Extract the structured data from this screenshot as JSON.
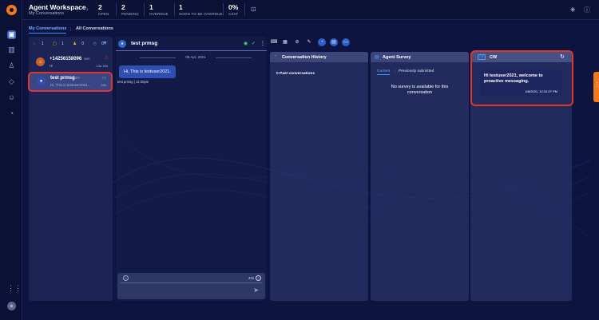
{
  "header": {
    "app_title": "Agent Workspace",
    "app_subtitle": "My Conversations",
    "crumb_icon": "chevron-right-icon",
    "stats": [
      {
        "value": "2",
        "label": "OPEN"
      },
      {
        "value": "2",
        "label": "PENDING"
      },
      {
        "value": "1",
        "label": "OVERDUE"
      },
      {
        "value": "1",
        "label": "SOON TO BE OVERDUE"
      },
      {
        "value": "0%",
        "label": "CSAT"
      }
    ]
  },
  "tabs": {
    "my_conversations": "My Conversations",
    "all_conversations": "All Conversations"
  },
  "filters": {
    "counts": [
      "1",
      "1",
      "0",
      "0"
    ],
    "icons": [
      "fire-icon",
      "chat-icon",
      "group-icon",
      "clock-icon"
    ]
  },
  "conversations": [
    {
      "name": "+14256158096",
      "channel": "SMS",
      "preview": "Hi",
      "time": "-13d 16h",
      "status_icon": "bell-icon",
      "status_color": "#e3342f"
    },
    {
      "name": "test prmsg",
      "channel": "APP",
      "preview": "Hi, This is testuser2021...",
      "time": "59s",
      "status_icon": "chat-icon",
      "status_color": "#4cd964"
    }
  ],
  "chat": {
    "contact_name": "test prmsg",
    "date": "08 Apr, 2021",
    "message": "Hi, This is testuser2021.",
    "meta": "test prmsg  |  12:30pm",
    "char_count": "43s"
  },
  "history": {
    "title": "Conversation History",
    "count_text": "0 Past conversations"
  },
  "survey": {
    "title": "Agent Survey",
    "tab_current": "Current",
    "tab_previous": "Previously submitted",
    "empty_message": "No survey is available for this conversation"
  },
  "cw": {
    "badge": "CW",
    "title": "CW",
    "message": "Hi testuser2021, welcome to proactive messaging.",
    "timestamp": "4/8/2021, 12:31:27 PM"
  },
  "colors": {
    "accent": "#f0781f",
    "highlight": "#e3342f",
    "primary": "#3a64c8"
  }
}
